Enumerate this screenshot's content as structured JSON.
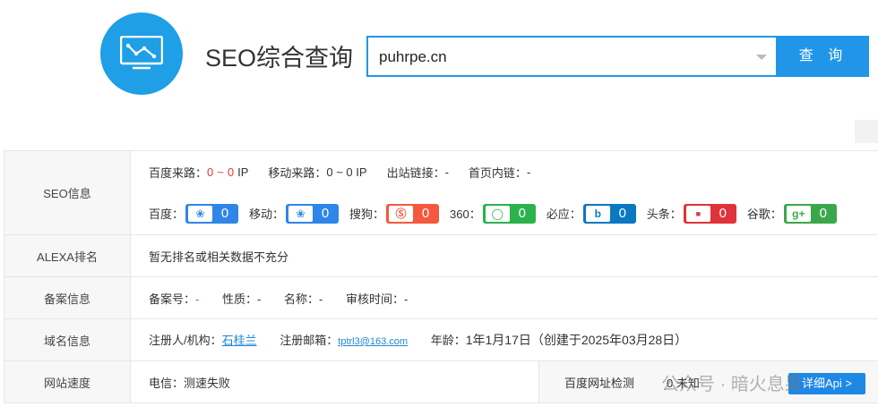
{
  "header": {
    "title": "SEO综合查询",
    "search_value": "puhrpe.cn",
    "search_button": "查 询"
  },
  "seo": {
    "label": "SEO信息",
    "baidu_source_label": "百度来路：",
    "baidu_source_a": "0",
    "tilde": "~",
    "baidu_source_b": "0",
    "ip": "IP",
    "mobile_source_label": "移动来路：",
    "mobile_source_value": "0 ~ 0 IP",
    "outlinks_label": "出站链接：",
    "outlinks_value": "-",
    "homelinks_label": "首页内链：",
    "homelinks_value": "-",
    "engines": [
      {
        "label": "百度：",
        "value": "0",
        "color": "#2f86e8",
        "icon": "paw-icon"
      },
      {
        "label": "移动：",
        "value": "0",
        "color": "#2f86e8",
        "icon": "paw-icon"
      },
      {
        "label": "搜狗：",
        "value": "0",
        "color": "#f4583f",
        "icon": "sogou-icon"
      },
      {
        "label": "360：",
        "value": "0",
        "color": "#2bb24c",
        "icon": "360-icon"
      },
      {
        "label": "必应：",
        "value": "0",
        "color": "#0b78c2",
        "icon": "bing-icon"
      },
      {
        "label": "头条：",
        "value": "0",
        "color": "#e0323a",
        "icon": "toutiao-icon"
      },
      {
        "label": "谷歌：",
        "value": "0",
        "color": "#3aa84a",
        "icon": "gplus-icon"
      }
    ]
  },
  "alexa": {
    "label": "ALEXA排名",
    "text": "暂无排名或相关数据不充分"
  },
  "beian": {
    "label": "备案信息",
    "no_label": "备案号：",
    "no_value": "-",
    "nature_label": "性质：",
    "nature_value": "-",
    "name_label": "名称：",
    "name_value": "-",
    "time_label": "审核时间：",
    "time_value": "-"
  },
  "domain": {
    "label": "域名信息",
    "registrant_label": "注册人/机构：",
    "registrant_value": "石桂兰",
    "email_label": "注册邮箱：",
    "email_value": "tptrl3@163.com",
    "age_label": "年龄：",
    "age_value": "1年1月17日",
    "created": "（创建于2025年03月28日）"
  },
  "speed": {
    "label": "网站速度",
    "telecom": "电信：测速失败",
    "baidu_check": "百度网址检测",
    "unknown": "0 未知",
    "detail_button": "详细Api >"
  },
  "watermark": "公众号 · 暗火息果"
}
